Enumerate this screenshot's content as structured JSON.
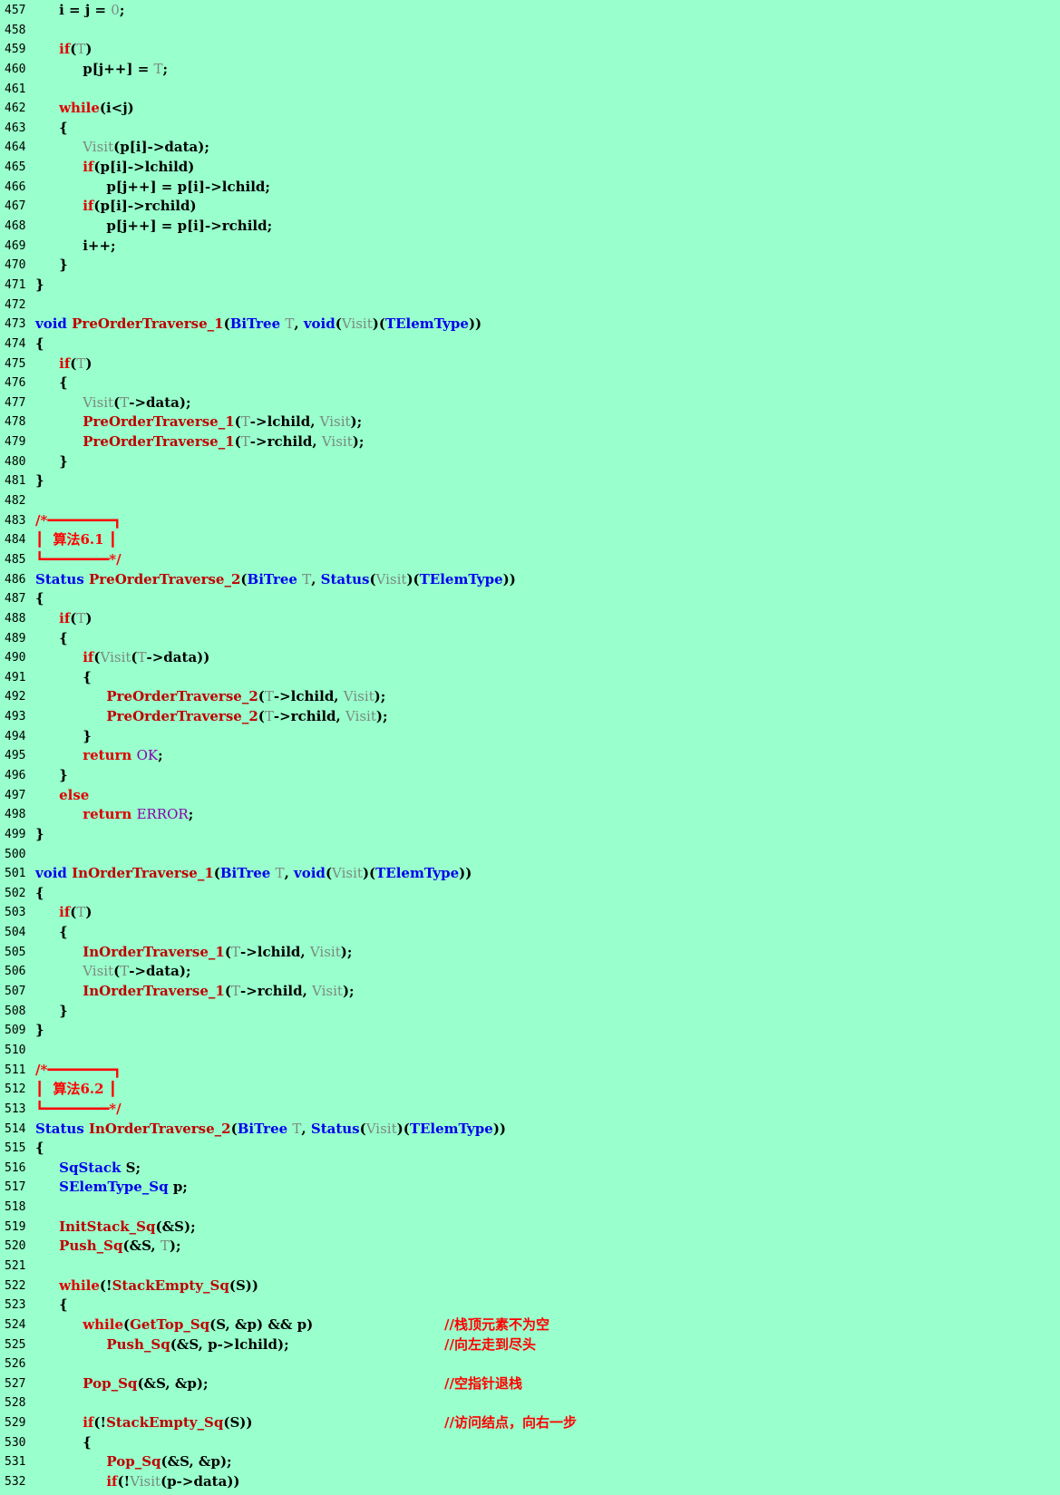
{
  "editor": {
    "lines": [
      {
        "n": "457",
        "code": "     <b>i = j = </b><span class=\"pm\">0</span>;"
      },
      {
        "n": "458",
        "code": ""
      },
      {
        "n": "459",
        "code": "     <span class=\"kw\">if</span>(<span class=\"pm\">T</span>)"
      },
      {
        "n": "460",
        "code": "          p[j++] = <span class=\"pm\">T</span>;"
      },
      {
        "n": "461",
        "code": ""
      },
      {
        "n": "462",
        "code": "     <span class=\"kw\">while</span>(i&lt;j)"
      },
      {
        "n": "463",
        "code": "     {"
      },
      {
        "n": "464",
        "code": "          <span class=\"pm\">Visit</span>(p[i]-&gt;data);"
      },
      {
        "n": "465",
        "code": "          <span class=\"kw\">if</span>(p[i]-&gt;lchild)"
      },
      {
        "n": "466",
        "code": "               p[j++] = p[i]-&gt;lchild;"
      },
      {
        "n": "467",
        "code": "          <span class=\"kw\">if</span>(p[i]-&gt;rchild)"
      },
      {
        "n": "468",
        "code": "               p[j++] = p[i]-&gt;rchild;"
      },
      {
        "n": "469",
        "code": "          i++;"
      },
      {
        "n": "470",
        "code": "     }"
      },
      {
        "n": "471",
        "code": "}"
      },
      {
        "n": "472",
        "code": ""
      },
      {
        "n": "473",
        "code": "<span class=\"ty\">void</span> <span class=\"fn\">PreOrderTraverse_1</span>(<span class=\"ty\">BiTree</span> <span class=\"pm\">T</span>, <span class=\"ty\">void</span>(<span class=\"pm\">Visit</span>)(<span class=\"ty\">TElemType</span>))"
      },
      {
        "n": "474",
        "code": "{"
      },
      {
        "n": "475",
        "code": "     <span class=\"kw\">if</span>(<span class=\"pm\">T</span>)"
      },
      {
        "n": "476",
        "code": "     {"
      },
      {
        "n": "477",
        "code": "          <span class=\"pm\">Visit</span>(<span class=\"pm\">T</span>-&gt;data);"
      },
      {
        "n": "478",
        "code": "          <span class=\"fn\">PreOrderTraverse_1</span>(<span class=\"pm\">T</span>-&gt;lchild, <span class=\"pm\">Visit</span>);"
      },
      {
        "n": "479",
        "code": "          <span class=\"fn\">PreOrderTraverse_1</span>(<span class=\"pm\">T</span>-&gt;rchild, <span class=\"pm\">Visit</span>);"
      },
      {
        "n": "480",
        "code": "     }"
      },
      {
        "n": "481",
        "code": "}"
      },
      {
        "n": "482",
        "code": ""
      },
      {
        "n": "483",
        "code": "<span class=\"box\">/*━━━━━━━━┓</span>"
      },
      {
        "n": "484",
        "code": "<span class=\"box\">┃  算法6.1 ┃</span>"
      },
      {
        "n": "485",
        "code": "<span class=\"box\">┗━━━━━━━━*/</span>"
      },
      {
        "n": "486",
        "code": "<span class=\"ty\">Status</span> <span class=\"fn\">PreOrderTraverse_2</span>(<span class=\"ty\">BiTree</span> <span class=\"pm\">T</span>, <span class=\"ty\">Status</span>(<span class=\"pm\">Visit</span>)(<span class=\"ty\">TElemType</span>))"
      },
      {
        "n": "487",
        "code": "{"
      },
      {
        "n": "488",
        "code": "     <span class=\"kw\">if</span>(<span class=\"pm\">T</span>)"
      },
      {
        "n": "489",
        "code": "     {"
      },
      {
        "n": "490",
        "code": "          <span class=\"kw\">if</span>(<span class=\"pm\">Visit</span>(<span class=\"pm\">T</span>-&gt;data))"
      },
      {
        "n": "491",
        "code": "          {"
      },
      {
        "n": "492",
        "code": "               <span class=\"fn\">PreOrderTraverse_2</span>(<span class=\"pm\">T</span>-&gt;lchild, <span class=\"pm\">Visit</span>);"
      },
      {
        "n": "493",
        "code": "               <span class=\"fn\">PreOrderTraverse_2</span>(<span class=\"pm\">T</span>-&gt;rchild, <span class=\"pm\">Visit</span>);"
      },
      {
        "n": "494",
        "code": "          }"
      },
      {
        "n": "495",
        "code": "          <span class=\"kw\">return</span> <span class=\"mc\">OK</span>;"
      },
      {
        "n": "496",
        "code": "     }"
      },
      {
        "n": "497",
        "code": "     <span class=\"kw\">else</span>"
      },
      {
        "n": "498",
        "code": "          <span class=\"kw\">return</span> <span class=\"mc\">ERROR</span>;"
      },
      {
        "n": "499",
        "code": "}"
      },
      {
        "n": "500",
        "code": ""
      },
      {
        "n": "501",
        "code": "<span class=\"ty\">void</span> <span class=\"fn\">InOrderTraverse_1</span>(<span class=\"ty\">BiTree</span> <span class=\"pm\">T</span>, <span class=\"ty\">void</span>(<span class=\"pm\">Visit</span>)(<span class=\"ty\">TElemType</span>))"
      },
      {
        "n": "502",
        "code": "{"
      },
      {
        "n": "503",
        "code": "     <span class=\"kw\">if</span>(<span class=\"pm\">T</span>)"
      },
      {
        "n": "504",
        "code": "     {"
      },
      {
        "n": "505",
        "code": "          <span class=\"fn\">InOrderTraverse_1</span>(<span class=\"pm\">T</span>-&gt;lchild, <span class=\"pm\">Visit</span>);"
      },
      {
        "n": "506",
        "code": "          <span class=\"pm\">Visit</span>(<span class=\"pm\">T</span>-&gt;data);"
      },
      {
        "n": "507",
        "code": "          <span class=\"fn\">InOrderTraverse_1</span>(<span class=\"pm\">T</span>-&gt;rchild, <span class=\"pm\">Visit</span>);"
      },
      {
        "n": "508",
        "code": "     }"
      },
      {
        "n": "509",
        "code": "}"
      },
      {
        "n": "510",
        "code": ""
      },
      {
        "n": "511",
        "code": "<span class=\"box\">/*━━━━━━━━┓</span>"
      },
      {
        "n": "512",
        "code": "<span class=\"box\">┃  算法6.2 ┃</span>"
      },
      {
        "n": "513",
        "code": "<span class=\"box\">┗━━━━━━━━*/</span>"
      },
      {
        "n": "514",
        "code": "<span class=\"ty\">Status</span> <span class=\"fn\">InOrderTraverse_2</span>(<span class=\"ty\">BiTree</span> <span class=\"pm\">T</span>, <span class=\"ty\">Status</span>(<span class=\"pm\">Visit</span>)(<span class=\"ty\">TElemType</span>))"
      },
      {
        "n": "515",
        "code": "{"
      },
      {
        "n": "516",
        "code": "     <span class=\"ty\">SqStack</span> S;"
      },
      {
        "n": "517",
        "code": "     <span class=\"ty\">SElemType_Sq</span> p;"
      },
      {
        "n": "518",
        "code": ""
      },
      {
        "n": "519",
        "code": "     <span class=\"fn\">InitStack_Sq</span>(&amp;S);"
      },
      {
        "n": "520",
        "code": "     <span class=\"fn\">Push_Sq</span>(&amp;S, <span class=\"pm\">T</span>);"
      },
      {
        "n": "521",
        "code": ""
      },
      {
        "n": "522",
        "code": "     <span class=\"kw\">while</span>(!<span class=\"fn\">StackEmpty_Sq</span>(S))"
      },
      {
        "n": "523",
        "code": "     {"
      },
      {
        "n": "524",
        "code": "          <span class=\"kw\">while</span>(<span class=\"fn\">GetTop_Sq</span>(S, &amp;p) &amp;&amp; p)",
        "comment": "//栈顶元素不为空"
      },
      {
        "n": "525",
        "code": "               <span class=\"fn\">Push_Sq</span>(&amp;S, p-&gt;lchild);",
        "comment": "//向左走到尽头"
      },
      {
        "n": "526",
        "code": ""
      },
      {
        "n": "527",
        "code": "          <span class=\"fn\">Pop_Sq</span>(&amp;S, &amp;p);",
        "comment": "//空指针退栈"
      },
      {
        "n": "528",
        "code": ""
      },
      {
        "n": "529",
        "code": "          <span class=\"kw\">if</span>(!<span class=\"fn\">StackEmpty_Sq</span>(S))",
        "comment": "//访问结点，向右一步"
      },
      {
        "n": "530",
        "code": "          {"
      },
      {
        "n": "531",
        "code": "               <span class=\"fn\">Pop_Sq</span>(&amp;S, &amp;p);"
      },
      {
        "n": "532",
        "code": "               <span class=\"kw\">if</span>(!<span class=\"pm\">Visit</span>(p-&gt;data))"
      }
    ]
  }
}
